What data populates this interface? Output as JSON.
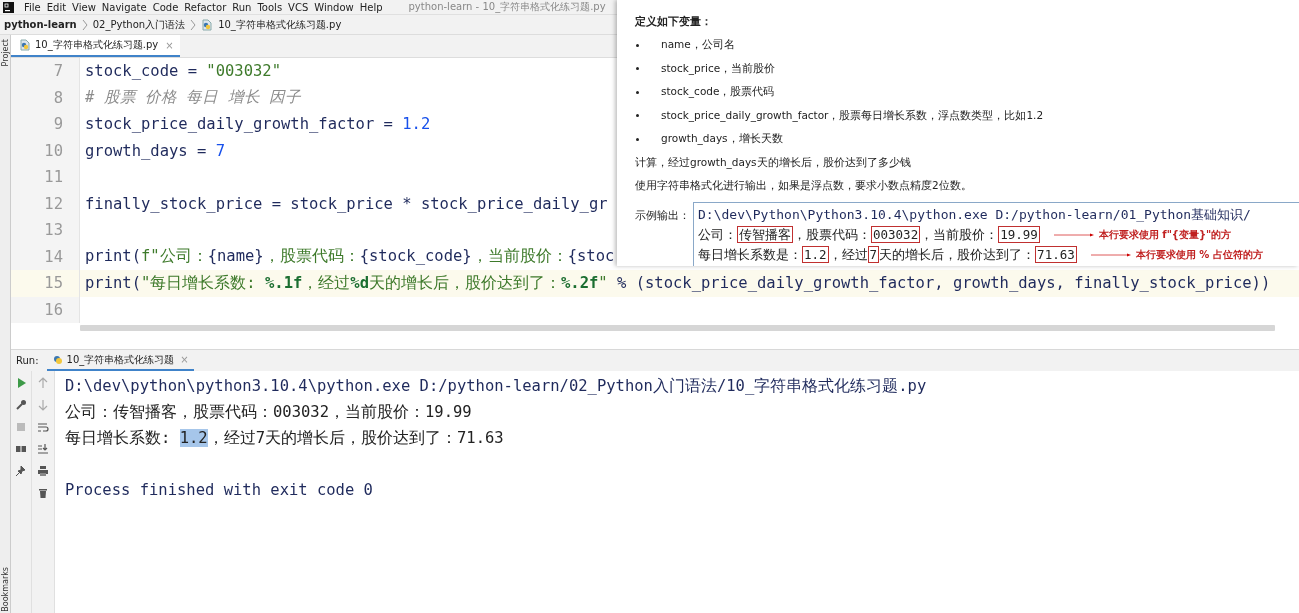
{
  "menu": [
    "File",
    "Edit",
    "View",
    "Navigate",
    "Code",
    "Refactor",
    "Run",
    "Tools",
    "VCS",
    "Window",
    "Help"
  ],
  "window": {
    "title": "python-learn - 10_字符串格式化练习题.py"
  },
  "breadcrumb": [
    "python-learn",
    "02_Python入门语法",
    "10_字符串格式化练习题.py"
  ],
  "side_labels": {
    "top": "Project",
    "bottom": "Bookmarks"
  },
  "editor_tabs": [
    {
      "label": "10_字符串格式化练习题.py",
      "close": "×",
      "selected": true
    }
  ],
  "code_lines": [
    {
      "number": "7",
      "current": false,
      "tokens": [
        {
          "kind": "text",
          "text": "stock_code = "
        },
        {
          "kind": "string",
          "text": "\"003032\""
        }
      ]
    },
    {
      "number": "8",
      "current": false,
      "tokens": [
        {
          "kind": "comment",
          "text": "# 股票 价格 每日 增长 因子"
        }
      ]
    },
    {
      "number": "9",
      "current": false,
      "tokens": [
        {
          "kind": "text",
          "text": "stock_price_daily_growth_factor = "
        },
        {
          "kind": "number",
          "text": "1.2"
        }
      ]
    },
    {
      "number": "10",
      "current": false,
      "tokens": [
        {
          "kind": "text",
          "text": "growth_days = "
        },
        {
          "kind": "number",
          "text": "7"
        }
      ]
    },
    {
      "number": "11",
      "current": false
    },
    {
      "number": "12",
      "current": false,
      "tokens": [
        {
          "kind": "text",
          "text": "finally_stock_price = stock_price * stock_price_daily_gr"
        }
      ]
    },
    {
      "number": "13",
      "current": false
    },
    {
      "number": "14",
      "current": false,
      "tokens": [
        {
          "kind": "text",
          "text": "print("
        },
        {
          "kind": "string",
          "text": "f\"公司："
        },
        {
          "kind": "brace",
          "text": "{name}"
        },
        {
          "kind": "string",
          "text": "，股票代码："
        },
        {
          "kind": "brace",
          "text": "{stock_code}"
        },
        {
          "kind": "string",
          "text": "，当前股价："
        },
        {
          "kind": "brace",
          "text": "{stoc"
        }
      ]
    },
    {
      "number": "15",
      "current": true,
      "tokens": [
        {
          "kind": "text",
          "text": "print("
        },
        {
          "kind": "string",
          "text": "\"每日增长系数: "
        },
        {
          "kind": "fmt",
          "text": "%.1f"
        },
        {
          "kind": "string",
          "text": "，经过"
        },
        {
          "kind": "fmt",
          "text": "%d"
        },
        {
          "kind": "string",
          "text": "天的增长后，股价达到了："
        },
        {
          "kind": "fmt",
          "text": "%.2f"
        },
        {
          "kind": "string",
          "text": "\""
        },
        {
          "kind": "text",
          "text": " % (stock_price_daily_growth_factor, growth_days, finally_stock_price))"
        }
      ]
    },
    {
      "number": "16",
      "current": false
    }
  ],
  "run_panel": {
    "label": "Run:",
    "tab": {
      "label": "10_字符串格式化练习题",
      "close": "×",
      "selected": true
    },
    "console": [
      {
        "kind": "command",
        "segments": [
          {
            "text": "D:\\dev\\python\\python3.10.4\\python.exe D:/python-learn/02_Python入门语法/10_字符串格式化练习题.py",
            "selected": false
          }
        ]
      },
      {
        "kind": "output",
        "segments": [
          {
            "text": "公司：传智播客，股票代码：003032，当前股价：19.99",
            "selected": false
          }
        ]
      },
      {
        "kind": "output",
        "segments": [
          {
            "text": "每日增长系数: ",
            "selected": false
          },
          {
            "text": "1.2",
            "selected": true
          },
          {
            "text": "，经过7天的增长后，股价达到了：71.63",
            "selected": false
          }
        ]
      },
      {
        "kind": "blank"
      },
      {
        "kind": "exit",
        "segments": [
          {
            "text": "Process finished with exit code 0",
            "selected": false
          }
        ]
      }
    ]
  },
  "task_panel": {
    "heading": "定义如下变量：",
    "bullets": [
      "name，公司名",
      "stock_price，当前股价",
      "stock_code，股票代码",
      "stock_price_daily_growth_factor，股票每日增长系数，浮点数类型，比如1.2",
      "growth_days，增长天数"
    ],
    "paragraphs": [
      "计算，经过growth_days天的增长后，股价达到了多少钱",
      "使用字符串格式化进行输出，如果是浮点数，要求小数点精度2位数。"
    ],
    "sample_label": "示例输出：",
    "sample_lines": [
      {
        "kind": "command",
        "segments": [
          {
            "text": "D:\\dev\\Python\\Python3.10.4\\python.exe D:/python-learn/01_Python基础知识/",
            "boxed": false
          }
        ]
      },
      {
        "kind": "output",
        "note": "本行要求使用 f\"{变量}\"的方",
        "segments": [
          {
            "text": "公司：",
            "boxed": false
          },
          {
            "text": "传智播客",
            "boxed": true
          },
          {
            "text": "，股票代码：",
            "boxed": false
          },
          {
            "text": "003032",
            "boxed": true
          },
          {
            "text": "，当前股价：",
            "boxed": false
          },
          {
            "text": "19.99",
            "boxed": true
          }
        ]
      },
      {
        "kind": "output",
        "note": "本行要求使用 % 占位符的方",
        "segments": [
          {
            "text": "每日增长系数是：",
            "boxed": false
          },
          {
            "text": "1.2",
            "boxed": true
          },
          {
            "text": "，经过",
            "boxed": false
          },
          {
            "text": "7",
            "boxed": true
          },
          {
            "text": "天的增长后，股价达到了：",
            "boxed": false
          },
          {
            "text": "71.63",
            "boxed": true
          }
        ]
      }
    ]
  }
}
